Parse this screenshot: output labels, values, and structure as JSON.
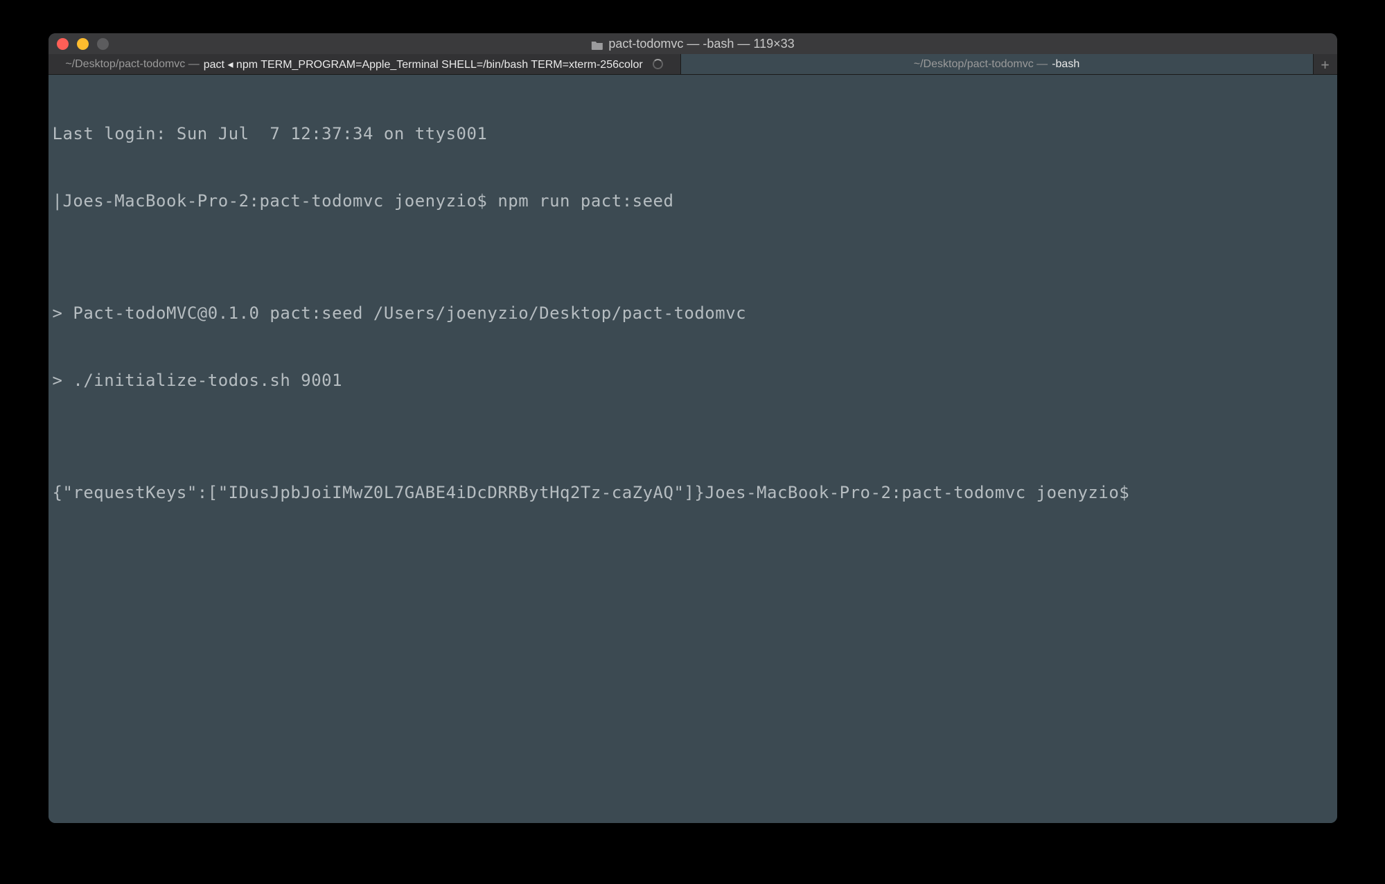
{
  "window": {
    "title": "pact-todomvc — -bash — 119×33",
    "folder_icon": "folder-icon"
  },
  "tabs": [
    {
      "prefix": "~/Desktop/pact-todomvc — ",
      "bold": "pact ◂ npm TERM_PROGRAM=Apple_Terminal SHELL=/bin/bash TERM=xterm-256color",
      "spinner": true,
      "active": false
    },
    {
      "prefix": "~/Desktop/pact-todomvc — ",
      "bold": "-bash",
      "spinner": false,
      "active": true
    }
  ],
  "new_tab_label": "+",
  "terminal_lines": [
    "Last login: Sun Jul  7 12:37:34 on ttys001",
    "|Joes-MacBook-Pro-2:pact-todomvc joenyzio$ npm run pact:seed",
    "",
    "> Pact-todoMVC@0.1.0 pact:seed /Users/joenyzio/Desktop/pact-todomvc",
    "> ./initialize-todos.sh 9001",
    "",
    "{\"requestKeys\":[\"IDusJpbJoiIMwZ0L7GABE4iDcDRRBytHq2Tz-caZyAQ\"]}Joes-MacBook-Pro-2:pact-todomvc joenyzio$ "
  ]
}
